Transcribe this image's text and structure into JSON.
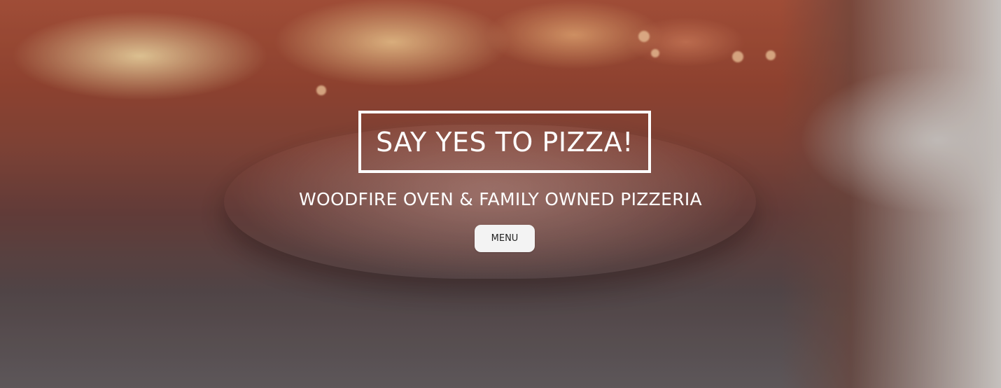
{
  "hero": {
    "title": "SAY YES TO PIZZA!",
    "subtitle": "WOODFIRE OVEN & FAMILY OWNED PIZZERIA",
    "menu_button_label": "MENU",
    "background_image": "woodfire-oven-pizza-photo"
  },
  "colors": {
    "text": "#ffffff",
    "button_bg": "#f3f3f3",
    "button_text": "#222222"
  }
}
